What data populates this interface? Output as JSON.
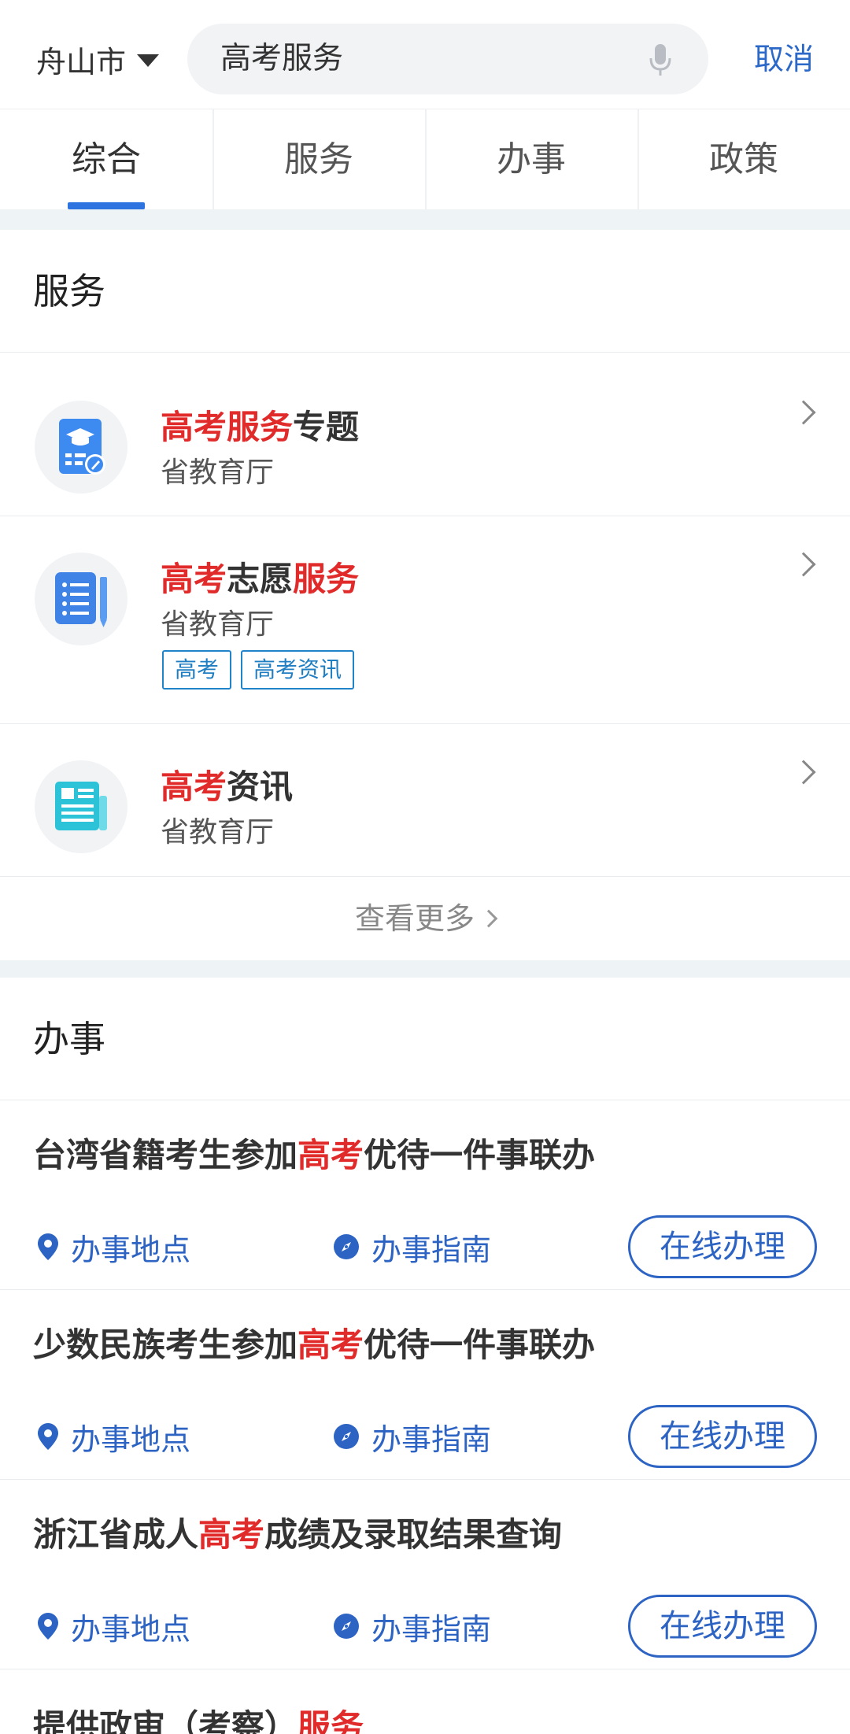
{
  "header": {
    "city": "舟山市",
    "search_value": "高考服务",
    "cancel_label": "取消"
  },
  "tabs": [
    {
      "label": "综合",
      "active": true
    },
    {
      "label": "服务",
      "active": false
    },
    {
      "label": "办事",
      "active": false
    },
    {
      "label": "政策",
      "active": false
    }
  ],
  "services": {
    "section_title": "服务",
    "items": [
      {
        "title_parts": [
          {
            "text": "高考服务",
            "highlight": true
          },
          {
            "text": "专题",
            "highlight": false
          }
        ],
        "department": "省教育厅",
        "icon": "graduation-cap-doc-icon",
        "tags": []
      },
      {
        "title_parts": [
          {
            "text": "高考",
            "highlight": true
          },
          {
            "text": "志愿",
            "highlight": false
          },
          {
            "text": "服务",
            "highlight": true
          }
        ],
        "department": "省教育厅",
        "icon": "list-notepad-icon",
        "tags": [
          "高考",
          "高考资讯"
        ]
      },
      {
        "title_parts": [
          {
            "text": "高考",
            "highlight": true
          },
          {
            "text": "资讯",
            "highlight": false
          }
        ],
        "department": "省教育厅",
        "icon": "newspaper-icon",
        "tags": []
      }
    ],
    "more_label": "查看更多"
  },
  "affairs": {
    "section_title": "办事",
    "location_label": "办事地点",
    "guide_label": "办事指南",
    "online_label": "在线办理",
    "items": [
      {
        "title_parts": [
          {
            "text": "台湾省籍考生参加",
            "highlight": false
          },
          {
            "text": "高考",
            "highlight": true
          },
          {
            "text": "优待一件事联办",
            "highlight": false
          }
        ]
      },
      {
        "title_parts": [
          {
            "text": "少数民族考生参加",
            "highlight": false
          },
          {
            "text": "高考",
            "highlight": true
          },
          {
            "text": "优待一件事联办",
            "highlight": false
          }
        ]
      },
      {
        "title_parts": [
          {
            "text": "浙江省成人",
            "highlight": false
          },
          {
            "text": "高考",
            "highlight": true
          },
          {
            "text": "成绩及录取结果查询",
            "highlight": false
          }
        ]
      }
    ],
    "partial_item": {
      "title_parts": [
        {
          "text": "提供政审（考察）",
          "highlight": false
        },
        {
          "text": "服务",
          "highlight": true
        }
      ]
    }
  },
  "colors": {
    "accent_blue": "#2c68c8",
    "highlight_red": "#e12a2a",
    "tab_indicator": "#2d74e0"
  }
}
